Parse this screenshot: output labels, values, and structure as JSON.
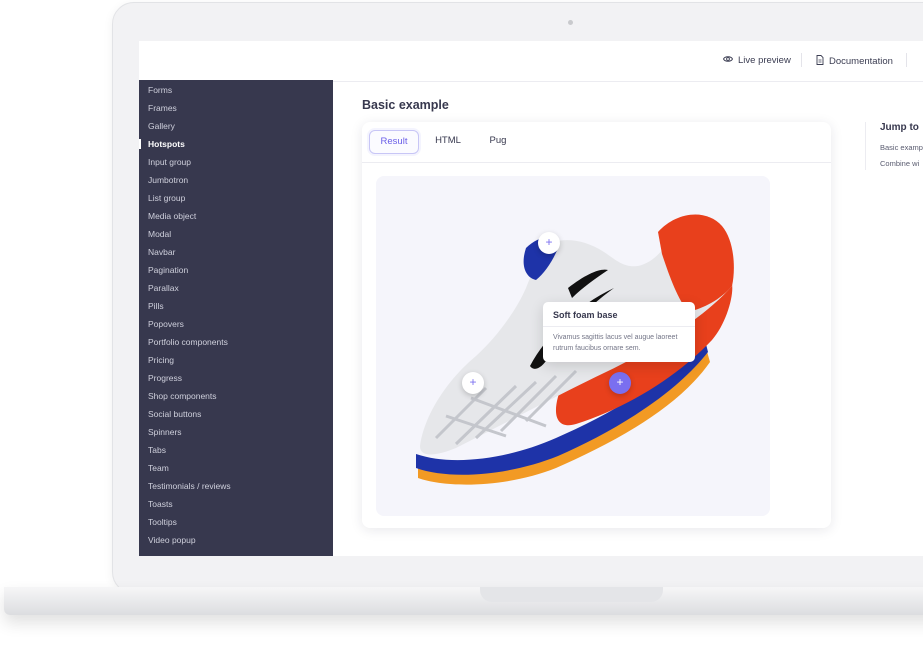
{
  "topbar": {
    "live_preview": "Live preview",
    "documentation": "Documentation"
  },
  "sidebar": {
    "items": [
      {
        "label": "Forms"
      },
      {
        "label": "Frames"
      },
      {
        "label": "Gallery"
      },
      {
        "label": "Hotspots",
        "active": true
      },
      {
        "label": "Input group"
      },
      {
        "label": "Jumbotron"
      },
      {
        "label": "List group"
      },
      {
        "label": "Media object"
      },
      {
        "label": "Modal"
      },
      {
        "label": "Navbar"
      },
      {
        "label": "Pagination"
      },
      {
        "label": "Parallax"
      },
      {
        "label": "Pills"
      },
      {
        "label": "Popovers"
      },
      {
        "label": "Portfolio components"
      },
      {
        "label": "Pricing"
      },
      {
        "label": "Progress"
      },
      {
        "label": "Shop components"
      },
      {
        "label": "Social buttons"
      },
      {
        "label": "Spinners"
      },
      {
        "label": "Tabs"
      },
      {
        "label": "Team"
      },
      {
        "label": "Testimonials / reviews"
      },
      {
        "label": "Toasts"
      },
      {
        "label": "Tooltips"
      },
      {
        "label": "Video popup"
      }
    ]
  },
  "main": {
    "title": "Basic example",
    "tabs": [
      {
        "label": "Result",
        "active": true
      },
      {
        "label": "HTML"
      },
      {
        "label": "Pug"
      }
    ],
    "hotspot_symbol": "+",
    "popover": {
      "title": "Soft foam base",
      "body": "Vivamus sagittis lacus vel augue laoreet rutrum faucibus ornare sem."
    }
  },
  "jump_to": {
    "title": "Jump to",
    "links": [
      "Basic examp",
      "Combine wi"
    ]
  },
  "colors": {
    "sidebar_bg": "#37384e",
    "accent": "#7a6ff0",
    "shoe_red": "#e8401c",
    "shoe_blue": "#1e33a8"
  }
}
